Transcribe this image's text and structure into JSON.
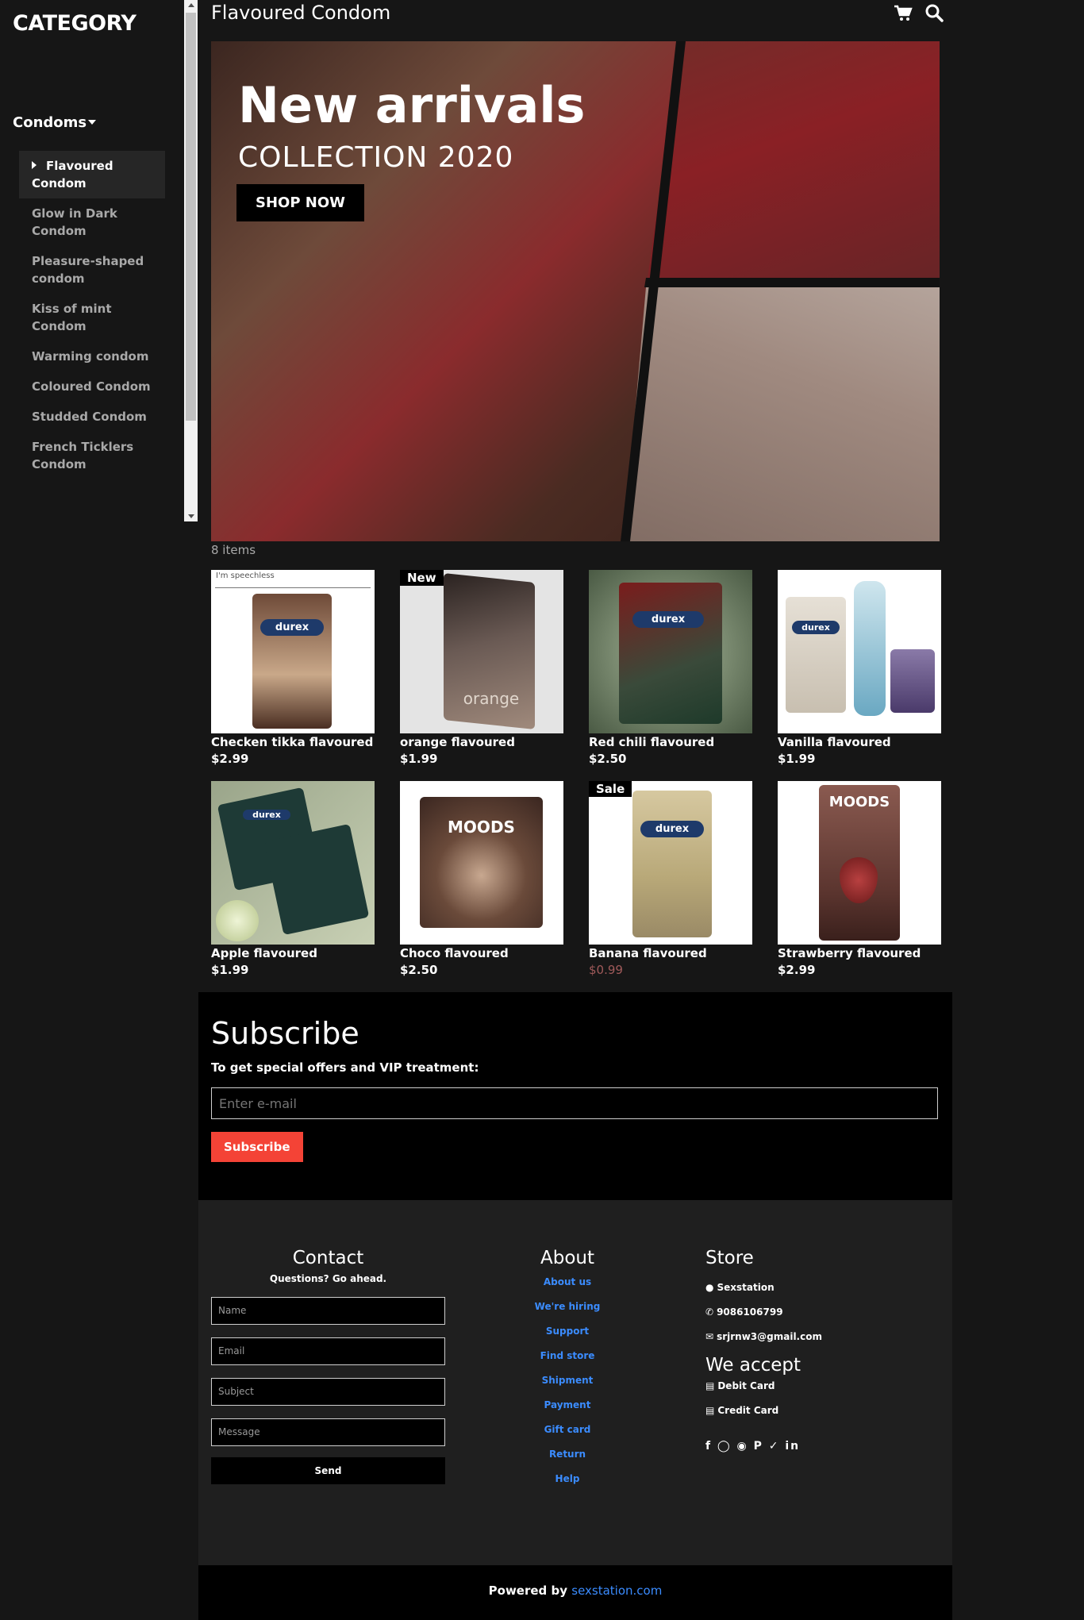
{
  "sidebar": {
    "title": "CATEGORY",
    "group": "Condoms",
    "items": [
      {
        "label": "Flavoured Condom",
        "active": true
      },
      {
        "label": "Glow in Dark Condom"
      },
      {
        "label": "Pleasure-shaped condom"
      },
      {
        "label": "Kiss of mint Condom"
      },
      {
        "label": "Warming condom"
      },
      {
        "label": "Coloured Condom"
      },
      {
        "label": "Studded Condom"
      },
      {
        "label": "French Ticklers Condom"
      }
    ]
  },
  "header": {
    "title": "Flavoured Condom",
    "icons": [
      "cart-icon",
      "search-icon"
    ]
  },
  "hero": {
    "headline": "New arrivals",
    "subheadline": "COLLECTION 2020",
    "cta": "SHOP NOW"
  },
  "items_count": "8 items",
  "products": [
    {
      "name": "Checken tikka flavoured",
      "price": "$2.99",
      "badge": "",
      "image_text": "I'm speechless",
      "box_label": "durex",
      "color": "#5b3a2a"
    },
    {
      "name": "orange flavoured",
      "price": "$1.99",
      "badge": "New",
      "image_text": "",
      "box_label": "orange",
      "color": "#4a3a36"
    },
    {
      "name": "Red chili flavoured",
      "price": "$2.50",
      "badge": "",
      "image_text": "",
      "box_label": "durex",
      "color": "#7a1c1c"
    },
    {
      "name": "Vanilla flavoured",
      "price": "$1.99",
      "badge": "",
      "image_text": "",
      "box_label": "durex",
      "color": "#cfc6b8"
    },
    {
      "name": "Apple flavoured",
      "price": "$1.99",
      "badge": "",
      "image_text": "",
      "box_label": "durex",
      "color": "#2e4a3a"
    },
    {
      "name": "Choco flavoured",
      "price": "$2.50",
      "badge": "",
      "image_text": "",
      "box_label": "MOODS",
      "color": "#5a3a2e"
    },
    {
      "name": "Banana flavoured",
      "price": "$0.99",
      "badge": "Sale",
      "image_text": "",
      "box_label": "durex",
      "color": "#c8b890"
    },
    {
      "name": "Strawberry flavoured",
      "price": "$2.99",
      "badge": "",
      "image_text": "",
      "box_label": "MOODS",
      "color": "#6a3a32"
    }
  ],
  "subscribe": {
    "title": "Subscribe",
    "text": "To get special offers and VIP treatment:",
    "placeholder": "Enter e-mail",
    "button": "Subscribe"
  },
  "footer": {
    "contact": {
      "title": "Contact",
      "subtitle": "Questions? Go ahead.",
      "fields": [
        "Name",
        "Email",
        "Subject",
        "Message"
      ],
      "send": "Send"
    },
    "about": {
      "title": "About",
      "links": [
        "About us",
        "We're hiring",
        "Support",
        "Find store",
        "Shipment",
        "Payment",
        "Gift card",
        "Return",
        "Help"
      ]
    },
    "store": {
      "title": "Store",
      "name": "Sexstation",
      "phone": "9086106799",
      "email": "srjrnw3@gmail.com",
      "accept_title": "We accept",
      "debit": "Debit Card",
      "credit": "Credit Card",
      "socials": [
        "facebook-icon",
        "instagram-icon",
        "snapchat-icon",
        "pinterest-icon",
        "twitter-icon",
        "linkedin-icon"
      ]
    }
  },
  "powered": {
    "prefix": "Powered by",
    "link": "sexstation.com"
  },
  "colors": {
    "accent_red": "#f44336",
    "link_blue": "#3b8cff",
    "bg": "#161616"
  }
}
